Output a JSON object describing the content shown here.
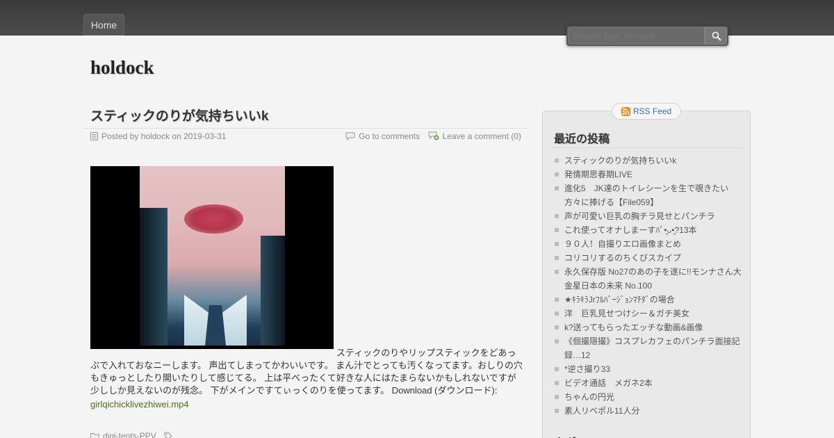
{
  "nav": {
    "home_label": "Home"
  },
  "search": {
    "placeholder": "Search: type, hit enter"
  },
  "site": {
    "title": "holdock"
  },
  "post": {
    "title": "スティックのりが気持ちいいk",
    "meta_posted": "Posted by holdock on 2019-03-31",
    "comments_link": "Go to comments",
    "leave_comment": "Leave a comment (0)",
    "body": "スティックのりやリップスティックをどあっぷで入れておなニーします。 声出てしまってかわいいです。 まん汁でとっても汚くなってます。おしりの穴もきゅっとしたり開いたりして感じてる。 上は平べったくて好きな人にはたまらないかもしれないですが少ししか見えないのが残念。 下がメインですてぃっくのりを使ってます。 Download (ダウンロード):",
    "download_link": "girlqichicklivezhiwei.mp4",
    "category": "digi-tents-PPV"
  },
  "sidebar": {
    "rss_label": "RSS Feed",
    "recent_title": "最近の投稿",
    "recent_posts": [
      "スティックのりが気持ちいいk",
      "発情期思春期LIVE",
      "進化5　JK達のトイレシーンを生で覗きたい方々に捧げる【File059】",
      "声が可愛い巨乳の胸チラ見せとパンチラ",
      "これ使ってオナしまーすﾊﾞ•͈ᴗ•͈?13本",
      "９０人！自撮りエロ画像まとめ",
      "コリコリするのちくびスカイプ",
      "永久保存版 No27のあの子を遂に!!モンナさん大金星日本の未来 No.100",
      "★ｷﾗｷﾗJrﾌﾙﾊﾞｰｼﾞｮﾝﾏﾁﾀﾞの場合",
      "洋　巨乳見せつけシー＆ガチ美女",
      "k?送ってもらったエッチな動画&画像",
      "《個撮隠撮》コスプレカフェのパンチラ面接記録…12",
      "*逆さ撮り33",
      "ビデオ通話　メガネ2本",
      "ちゃんの円光",
      "素人リベポル11人分"
    ],
    "tags_title": "タグ"
  }
}
